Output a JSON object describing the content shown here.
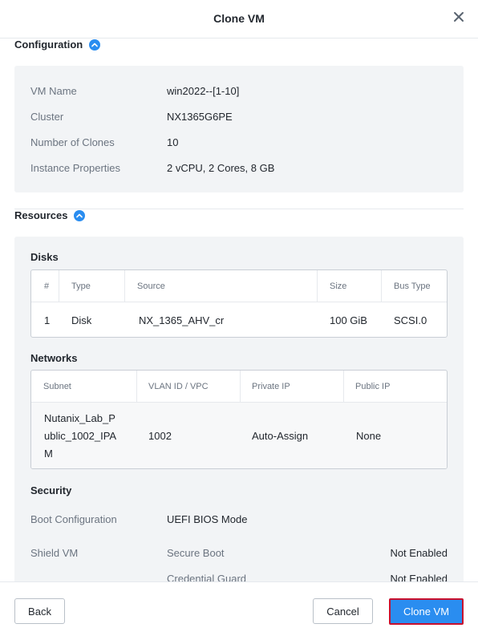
{
  "dialog": {
    "title": "Clone VM"
  },
  "configuration": {
    "heading": "Configuration",
    "rows": [
      {
        "label": "VM Name",
        "value": "win2022--[1-10]"
      },
      {
        "label": "Cluster",
        "value": "NX1365G6PE"
      },
      {
        "label": "Number of Clones",
        "value": "10"
      },
      {
        "label": "Instance Properties",
        "value": "2 vCPU, 2 Cores, 8 GB"
      }
    ]
  },
  "resources": {
    "heading": "Resources",
    "disks": {
      "heading": "Disks",
      "columns": [
        "#",
        "Type",
        "Source",
        "Size",
        "Bus Type"
      ],
      "rows": [
        {
          "num": "1",
          "type": "Disk",
          "source": "NX_1365_AHV_cr",
          "size": "100 GiB",
          "bus": "SCSI.0"
        }
      ]
    },
    "networks": {
      "heading": "Networks",
      "columns": [
        "Subnet",
        "VLAN ID / VPC",
        "Private IP",
        "Public IP"
      ],
      "rows": [
        {
          "subnet_line1": "Nutanix_Lab_P",
          "subnet_line2": "ublic_1002_IPA",
          "subnet_line3": "M",
          "vlan": "1002",
          "private_ip": "Auto-Assign",
          "public_ip": "None"
        }
      ]
    },
    "security": {
      "heading": "Security",
      "boot_label": "Boot Configuration",
      "boot_value": "UEFI BIOS Mode",
      "shield_label": "Shield VM",
      "items": [
        {
          "name": "Secure Boot",
          "status": "Not Enabled"
        },
        {
          "name": "Credential Guard",
          "status": "Not Enabled"
        }
      ]
    }
  },
  "footer": {
    "back_label": "Back",
    "cancel_label": "Cancel",
    "clone_label": "Clone VM"
  },
  "colors": {
    "accent": "#2a8df0",
    "highlight_border": "#c8102e",
    "panel_bg": "#f2f4f6"
  }
}
